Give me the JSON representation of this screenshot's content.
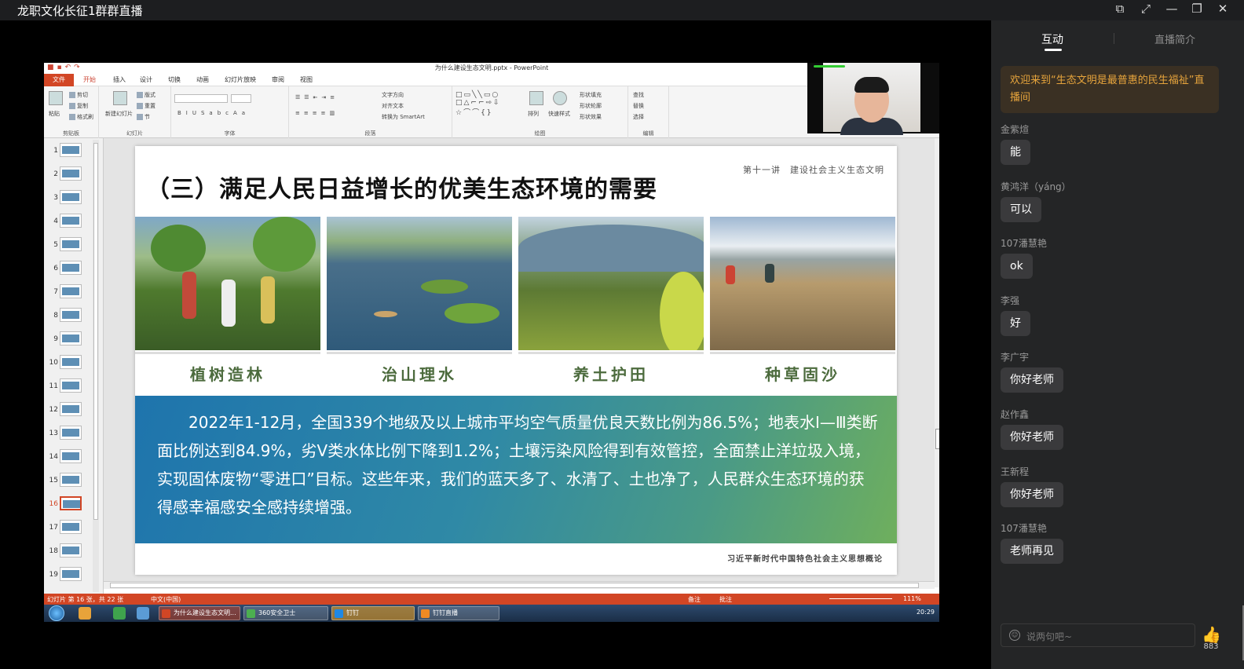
{
  "window": {
    "title": "龙职文化长征1群群直播",
    "controls": [
      "⧉",
      "⤢",
      "—",
      "❐",
      "✕"
    ]
  },
  "ppt": {
    "title": "为什么建设生态文明.pptx - PowerPoint",
    "tabs": [
      "文件",
      "开始",
      "插入",
      "设计",
      "切换",
      "动画",
      "幻灯片放映",
      "审阅",
      "视图"
    ],
    "groups": {
      "clipboard": "剪贴板",
      "slides": "幻灯片",
      "font": "字体",
      "paragraph": "段落",
      "drawing": "绘图",
      "editing": "编辑"
    },
    "buttons": {
      "cut": "剪切",
      "copy": "复制",
      "format_painter": "格式刷",
      "paste": "粘贴",
      "layout": "版式",
      "reset": "重置",
      "section": "节",
      "new_slide": "新建幻灯片",
      "text_direction": "文字方向",
      "align_text": "对齐文本",
      "smartart": "转换为 SmartArt",
      "arrange": "排列",
      "quick_styles": "快速样式",
      "shape_fill": "形状填充",
      "shape_outline": "形状轮廓",
      "shape_effects": "形状效果",
      "find": "查找",
      "replace": "替换",
      "select": "选择"
    },
    "thumbnails": [
      "1",
      "2",
      "3",
      "4",
      "5",
      "6",
      "7",
      "8",
      "9",
      "10",
      "11",
      "12",
      "13",
      "14",
      "15",
      "16",
      "17",
      "18",
      "19"
    ],
    "selected_thumbnail": "16",
    "slide": {
      "title": "（三）满足人民日益增长的优美生态环境的需要",
      "subtitle": "第十一讲　建设社会主义生态文明",
      "captions": [
        "植树造林",
        "治山理水",
        "养土护田",
        "种草固沙"
      ],
      "body": "2022年1-12月，全国339个地级及以上城市平均空气质量优良天数比例为86.5%；地表水Ⅰ—Ⅲ类断面比例达到84.9%，劣Ⅴ类水体比例下降到1.2%；土壤污染风险得到有效管控，全面禁止洋垃圾入境，实现固体废物“零进口”目标。这些年来，我们的蓝天多了、水清了、土也净了，人民群众生态环境的获得感幸福感安全感持续增强。",
      "footer": "习近平新时代中国特色社会主义思想概论"
    },
    "status": {
      "slide_info": "幻灯片 第 16 张，共 22 张",
      "language": "中文(中国)",
      "notes": "备注",
      "comments": "批注",
      "zoom": "111%"
    },
    "taskbar": {
      "tasks": [
        "为什么建设生态文明...",
        "360安全卫士",
        "钉钉",
        "钉钉直播"
      ],
      "clock": "20:29"
    }
  },
  "side": {
    "tabs": [
      "互动",
      "直播简介"
    ],
    "welcome": "欢迎来到“生态文明是最普惠的民生福祉”直播间",
    "messages": [
      {
        "user": "金紫煊",
        "text": "能"
      },
      {
        "user": "黄鸿洋（yáng）",
        "text": "可以"
      },
      {
        "user": "107潘慧艳",
        "text": "ok"
      },
      {
        "user": "李强",
        "text": "好"
      },
      {
        "user": "李广宇",
        "text": "你好老师"
      },
      {
        "user": "赵作鑫",
        "text": "你好老师"
      },
      {
        "user": "王新程",
        "text": "你好老师"
      },
      {
        "user": "107潘慧艳",
        "text": "老师再见"
      }
    ],
    "input_placeholder": "说两句吧~",
    "like_count": "883"
  },
  "colors": {
    "ppt_accent": "#d24625",
    "welcome_text": "#e6a43c",
    "side_bg": "#242526"
  }
}
